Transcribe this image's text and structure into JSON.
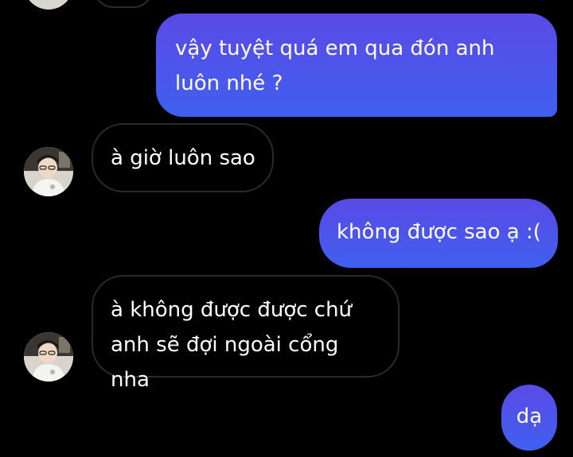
{
  "messages": [
    {
      "id": "m1",
      "direction": "sent",
      "text": "vậy tuyệt quá em qua đón anh luôn nhé ?"
    },
    {
      "id": "m2",
      "direction": "received",
      "text": "à giờ luôn sao"
    },
    {
      "id": "m3",
      "direction": "sent",
      "text": "không được sao ạ :("
    },
    {
      "id": "m4",
      "direction": "received",
      "lines": [
        "à không được được chứ",
        "anh sẽ đợi ngoài cổng nha"
      ]
    },
    {
      "id": "m5",
      "direction": "sent",
      "text": "dạ"
    }
  ],
  "colors": {
    "background": "#000000",
    "sent_bubble": "#4f55ec",
    "received_bubble_border": "#2a2a2a",
    "text": "#ffffff"
  },
  "icons": {
    "contact_avatar": "contact-avatar-photo"
  }
}
